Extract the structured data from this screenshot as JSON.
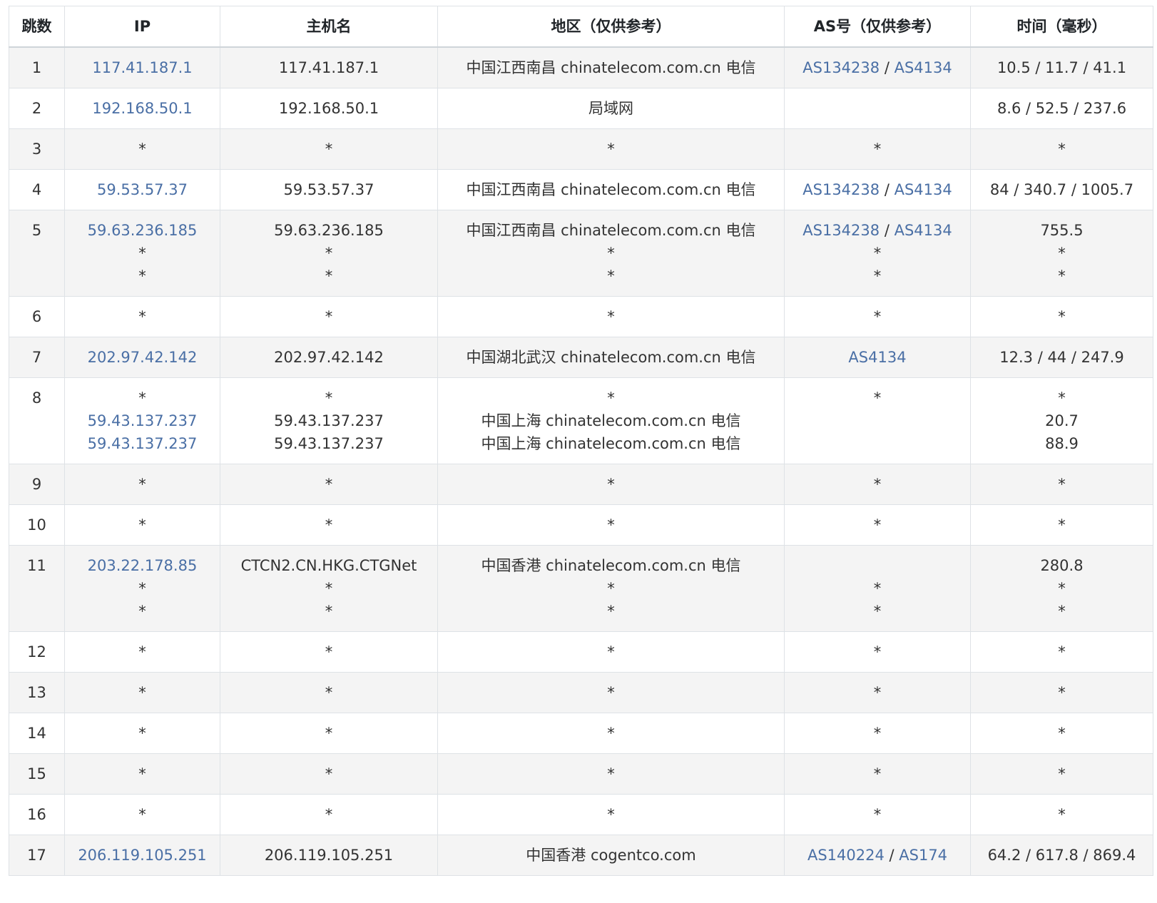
{
  "headers": [
    "跳数",
    "IP",
    "主机名",
    "地区（仅供参考）",
    "AS号（仅供参考）",
    "时间（毫秒）"
  ],
  "rows": [
    {
      "hop": "1",
      "ip": [
        "117.41.187.1"
      ],
      "host": [
        "117.41.187.1"
      ],
      "region": [
        "中国江西南昌 chinatelecom.com.cn 电信"
      ],
      "as": [
        [
          "AS134238",
          "AS4134"
        ]
      ],
      "time": [
        "10.5 / 11.7 / 41.1"
      ]
    },
    {
      "hop": "2",
      "ip": [
        "192.168.50.1"
      ],
      "host": [
        "192.168.50.1"
      ],
      "region": [
        "局域网"
      ],
      "as": [
        []
      ],
      "time": [
        "8.6 / 52.5 / 237.6"
      ]
    },
    {
      "hop": "3",
      "ip": [
        "*"
      ],
      "host": [
        "*"
      ],
      "region": [
        "*"
      ],
      "as": [
        [
          "*"
        ]
      ],
      "time": [
        "*"
      ]
    },
    {
      "hop": "4",
      "ip": [
        "59.53.57.37"
      ],
      "host": [
        "59.53.57.37"
      ],
      "region": [
        "中国江西南昌 chinatelecom.com.cn 电信"
      ],
      "as": [
        [
          "AS134238",
          "AS4134"
        ]
      ],
      "time": [
        "84 / 340.7 / 1005.7"
      ]
    },
    {
      "hop": "5",
      "ip": [
        "59.63.236.185",
        "*",
        "*"
      ],
      "host": [
        "59.63.236.185",
        "*",
        "*"
      ],
      "region": [
        "中国江西南昌 chinatelecom.com.cn 电信",
        "*",
        "*"
      ],
      "as": [
        [
          "AS134238",
          "AS4134"
        ],
        [
          "*"
        ],
        [
          "*"
        ]
      ],
      "time": [
        "755.5",
        "*",
        "*"
      ]
    },
    {
      "hop": "6",
      "ip": [
        "*"
      ],
      "host": [
        "*"
      ],
      "region": [
        "*"
      ],
      "as": [
        [
          "*"
        ]
      ],
      "time": [
        "*"
      ]
    },
    {
      "hop": "7",
      "ip": [
        "202.97.42.142"
      ],
      "host": [
        "202.97.42.142"
      ],
      "region": [
        "中国湖北武汉 chinatelecom.com.cn 电信"
      ],
      "as": [
        [
          "AS4134"
        ]
      ],
      "time": [
        "12.3 / 44 / 247.9"
      ]
    },
    {
      "hop": "8",
      "ip": [
        "*",
        "59.43.137.237",
        "59.43.137.237"
      ],
      "host": [
        "*",
        "59.43.137.237",
        "59.43.137.237"
      ],
      "region": [
        "*",
        "中国上海 chinatelecom.com.cn 电信",
        "中国上海 chinatelecom.com.cn 电信"
      ],
      "as": [
        [
          "*"
        ],
        [],
        []
      ],
      "time": [
        "*",
        "20.7",
        "88.9"
      ]
    },
    {
      "hop": "9",
      "ip": [
        "*"
      ],
      "host": [
        "*"
      ],
      "region": [
        "*"
      ],
      "as": [
        [
          "*"
        ]
      ],
      "time": [
        "*"
      ]
    },
    {
      "hop": "10",
      "ip": [
        "*"
      ],
      "host": [
        "*"
      ],
      "region": [
        "*"
      ],
      "as": [
        [
          "*"
        ]
      ],
      "time": [
        "*"
      ]
    },
    {
      "hop": "11",
      "ip": [
        "203.22.178.85",
        "*",
        "*"
      ],
      "host": [
        "CTCN2.CN.HKG.CTGNet",
        "*",
        "*"
      ],
      "region": [
        "中国香港 chinatelecom.com.cn 电信",
        "*",
        "*"
      ],
      "as": [
        [],
        [
          "*"
        ],
        [
          "*"
        ]
      ],
      "time": [
        "280.8",
        "*",
        "*"
      ]
    },
    {
      "hop": "12",
      "ip": [
        "*"
      ],
      "host": [
        "*"
      ],
      "region": [
        "*"
      ],
      "as": [
        [
          "*"
        ]
      ],
      "time": [
        "*"
      ]
    },
    {
      "hop": "13",
      "ip": [
        "*"
      ],
      "host": [
        "*"
      ],
      "region": [
        "*"
      ],
      "as": [
        [
          "*"
        ]
      ],
      "time": [
        "*"
      ]
    },
    {
      "hop": "14",
      "ip": [
        "*"
      ],
      "host": [
        "*"
      ],
      "region": [
        "*"
      ],
      "as": [
        [
          "*"
        ]
      ],
      "time": [
        "*"
      ]
    },
    {
      "hop": "15",
      "ip": [
        "*"
      ],
      "host": [
        "*"
      ],
      "region": [
        "*"
      ],
      "as": [
        [
          "*"
        ]
      ],
      "time": [
        "*"
      ]
    },
    {
      "hop": "16",
      "ip": [
        "*"
      ],
      "host": [
        "*"
      ],
      "region": [
        "*"
      ],
      "as": [
        [
          "*"
        ]
      ],
      "time": [
        "*"
      ]
    },
    {
      "hop": "17",
      "ip": [
        "206.119.105.251"
      ],
      "host": [
        "206.119.105.251"
      ],
      "region": [
        "中国香港 cogentco.com"
      ],
      "as": [
        [
          "AS140224",
          "AS174"
        ]
      ],
      "time": [
        "64.2 / 617.8 / 869.4"
      ]
    }
  ],
  "colors": {
    "link": "#4a6fa5",
    "stripe": "#f4f4f4",
    "border": "#dee2e6"
  }
}
